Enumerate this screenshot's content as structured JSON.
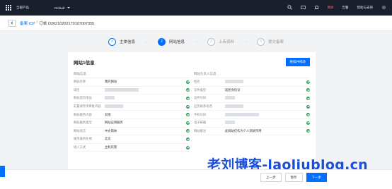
{
  "topbar": {
    "brand": "全部产品",
    "region": "Default",
    "lang_label": "简体",
    "alarm_label": "告警",
    "help_label": "帮助与支持"
  },
  "breadcrumb": {
    "root": "备案 ICP",
    "separator": "/",
    "current": "订单 O20210202170107007355"
  },
  "steps": [
    {
      "index": "✓",
      "label": "主体信息",
      "state": "done"
    },
    {
      "index": "2",
      "label": "网站信息",
      "state": "active"
    },
    {
      "index": "3",
      "label": "上传资料",
      "state": "pending"
    },
    {
      "index": "4",
      "label": "提交备案",
      "state": "pending"
    }
  ],
  "card": {
    "title": "网站1信息",
    "edit_button": "继续并修改",
    "left_section_title": "网站信息",
    "right_section_title": "网站负责人信息",
    "left_rows": [
      {
        "key": "网站名称",
        "value": "我的网站"
      },
      {
        "key": "域名",
        "value": ""
      },
      {
        "key": "网站首页地址",
        "value": ""
      },
      {
        "key": "前置或专项审批内容",
        "value": ""
      },
      {
        "key": "网站服务内容",
        "value": "其他"
      },
      {
        "key": "网站服务类型",
        "value": "网站应用服务"
      },
      {
        "key": "网站语言",
        "value": "中文简体"
      },
      {
        "key": "服务器所在地",
        "value": "北京"
      },
      {
        "key": "接入方式",
        "value": "主机托管"
      }
    ],
    "right_rows": [
      {
        "key": "姓名",
        "value": ""
      },
      {
        "key": "证件类型",
        "value": "居民身份证"
      },
      {
        "key": "证件号码",
        "value": ""
      },
      {
        "key": "应急联系电话",
        "value": ""
      },
      {
        "key": "手机号码",
        "value": ""
      },
      {
        "key": "电子邮箱",
        "value": ""
      },
      {
        "key": "网站备注",
        "value": "此网站仅作为个人测试所用"
      }
    ]
  },
  "footer": {
    "prev_label": "上一步",
    "save_label": "暂存",
    "next_label": "下一步"
  },
  "watermark": "老刘博客-laoliublog.cn",
  "colors": {
    "primary": "#006eff",
    "topbar": "#1a1f2e",
    "ok": "#29a35a"
  }
}
